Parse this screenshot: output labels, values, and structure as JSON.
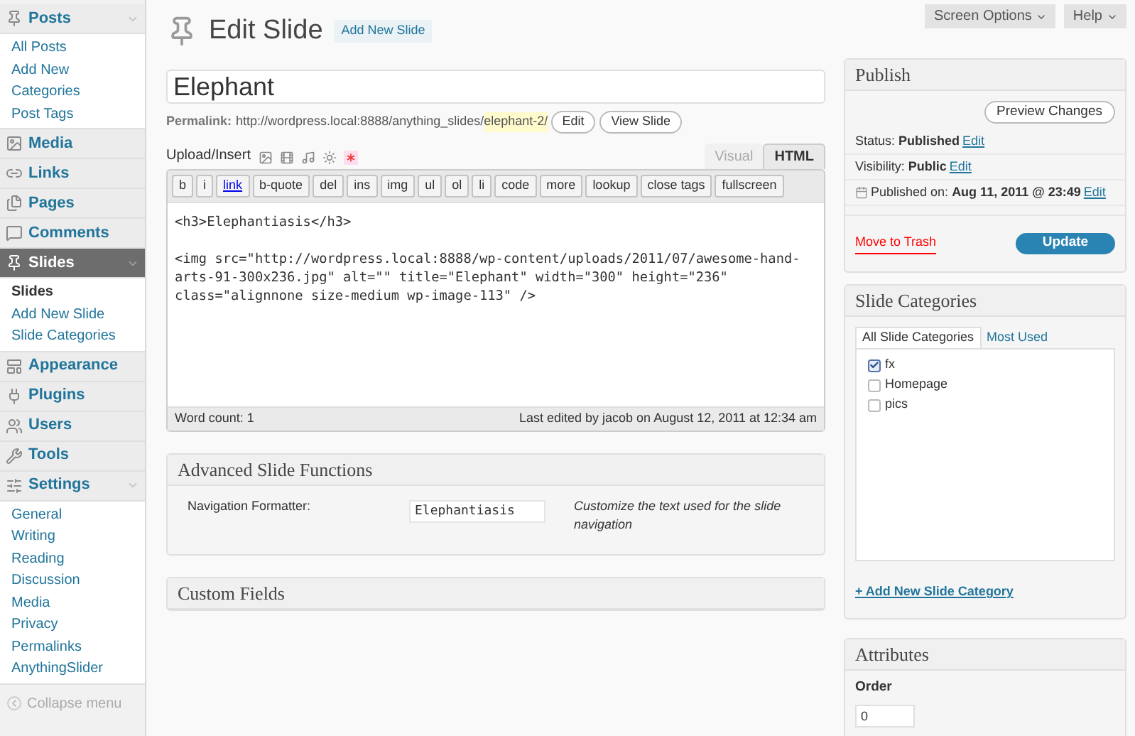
{
  "sidebar": {
    "menu": [
      {
        "label": "Posts",
        "selected": false,
        "expanded": true,
        "submenu": [
          {
            "label": "All Posts",
            "selected": false
          },
          {
            "label": "Add New",
            "selected": false
          },
          {
            "label": "Categories",
            "selected": false
          },
          {
            "label": "Post Tags",
            "selected": false
          }
        ]
      },
      {
        "label": "Media",
        "selected": false,
        "expanded": false
      },
      {
        "label": "Links",
        "selected": false,
        "expanded": false
      },
      {
        "label": "Pages",
        "selected": false,
        "expanded": false
      },
      {
        "label": "Comments",
        "selected": false,
        "expanded": false
      },
      {
        "label": "Slides",
        "selected": true,
        "expanded": true,
        "submenu": [
          {
            "label": "Slides",
            "selected": true
          },
          {
            "label": "Add New Slide",
            "selected": false
          },
          {
            "label": "Slide Categories",
            "selected": false
          }
        ]
      },
      {
        "label": "Appearance",
        "selected": false,
        "expanded": false
      },
      {
        "label": "Plugins",
        "selected": false,
        "expanded": false
      },
      {
        "label": "Users",
        "selected": false,
        "expanded": false
      },
      {
        "label": "Tools",
        "selected": false,
        "expanded": false
      },
      {
        "label": "Settings",
        "selected": false,
        "expanded": true,
        "submenu": [
          {
            "label": "General",
            "selected": false
          },
          {
            "label": "Writing",
            "selected": false
          },
          {
            "label": "Reading",
            "selected": false
          },
          {
            "label": "Discussion",
            "selected": false
          },
          {
            "label": "Media",
            "selected": false
          },
          {
            "label": "Privacy",
            "selected": false
          },
          {
            "label": "Permalinks",
            "selected": false
          },
          {
            "label": "AnythingSlider",
            "selected": false
          }
        ]
      }
    ],
    "collapse": "Collapse menu"
  },
  "header": {
    "title": "Edit Slide",
    "add_new": "Add New Slide",
    "screen_options": "Screen Options",
    "help": "Help"
  },
  "title_field": {
    "value": "Elephant"
  },
  "permalink": {
    "label": "Permalink:",
    "base": "http://wordpress.local:8888/anything_slides/",
    "slug": "elephant-2/",
    "edit": "Edit",
    "view": "View Slide"
  },
  "editor": {
    "upload_label": "Upload/Insert",
    "tabs": [
      {
        "label": "Visual",
        "selected": false
      },
      {
        "label": "HTML",
        "selected": true
      }
    ],
    "quicktags": [
      "b",
      "i",
      "link",
      "b-quote",
      "del",
      "ins",
      "img",
      "ul",
      "ol",
      "li",
      "code",
      "more",
      "lookup",
      "close tags",
      "fullscreen"
    ],
    "content": [
      {
        "lines": [
          "<h3>Elephantiasis</h3>"
        ]
      },
      {
        "lines": [
          "<img src=\"http://wordpress.local:8888/wp-content/uploads/2011/07/awesome-hand-",
          "arts-91-300x236.jpg\" alt=\"\" title=\"Elephant\" width=\"300\" height=\"236\"",
          "class=\"alignnone size-medium wp-image-113\" />"
        ]
      }
    ],
    "word_count": "Word count: 1",
    "last_edited": "Last edited by jacob on August 12, 2011 at 12:34 am"
  },
  "advanced": {
    "title": "Advanced Slide Functions",
    "label": "Navigation Formatter:",
    "value": "Elephantiasis",
    "description": "Customize the text used for the slide navigation"
  },
  "custom_fields": {
    "title": "Custom Fields"
  },
  "publish": {
    "title": "Publish",
    "preview": "Preview Changes",
    "rows": [
      {
        "label": "Status:",
        "value": "Published",
        "link": "Edit"
      },
      {
        "label": "Visibility:",
        "value": "Public",
        "link": "Edit"
      },
      {
        "label": "Published on:",
        "value": "Aug 11, 2011 @ 23:49",
        "link": "Edit"
      }
    ],
    "trash": "Move to Trash",
    "update": "Update"
  },
  "categories": {
    "title": "Slide Categories",
    "tabs": [
      {
        "label": "All Slide Categories",
        "selected": true
      },
      {
        "label": "Most Used",
        "selected": false
      }
    ],
    "items": [
      {
        "label": "fx",
        "checked": true
      },
      {
        "label": "Homepage",
        "checked": false
      },
      {
        "label": "pics",
        "checked": false
      }
    ],
    "add_link": "+ Add New Slide Category"
  },
  "attributes": {
    "title": "Attributes",
    "label": "Order",
    "value": "0"
  }
}
